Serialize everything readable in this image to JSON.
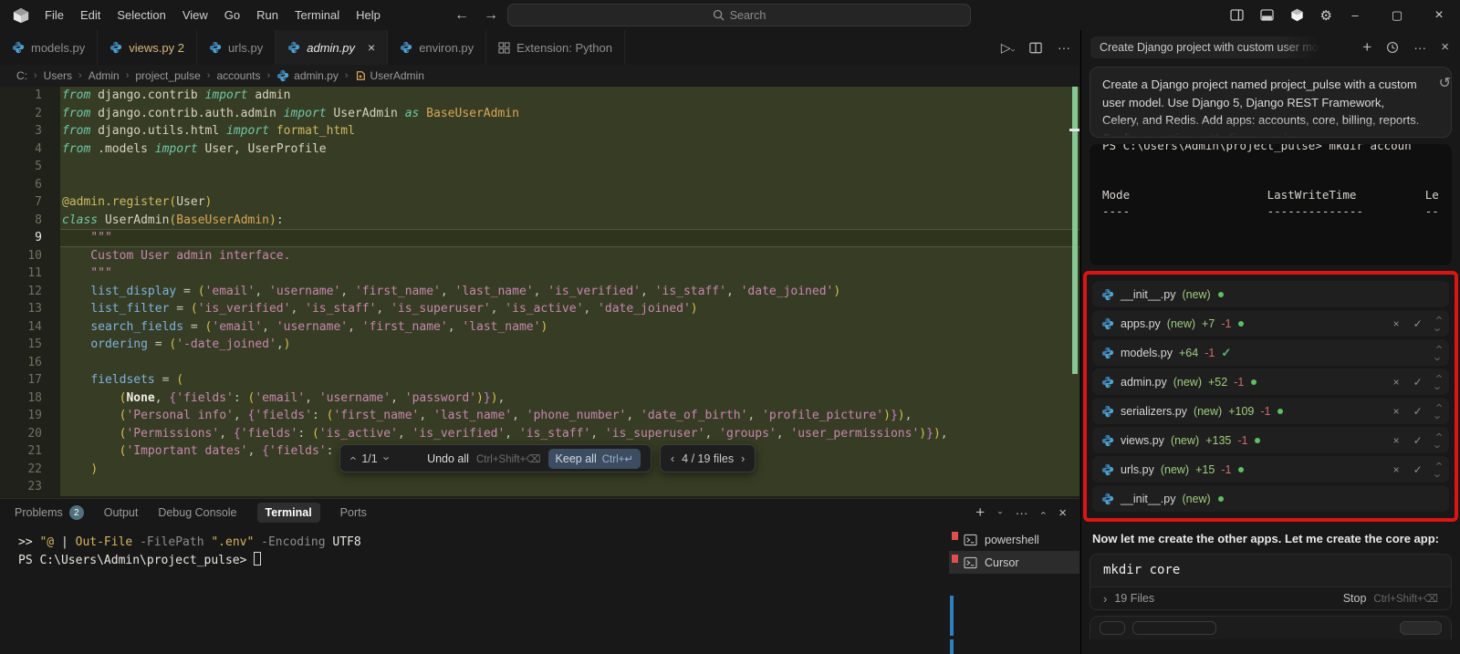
{
  "titlebar": {
    "menus": [
      "File",
      "Edit",
      "Selection",
      "View",
      "Go",
      "Run",
      "Terminal",
      "Help"
    ],
    "search_placeholder": "Search",
    "icons": {
      "back": "←",
      "forward": "→",
      "gear": "⚙",
      "minimize": "–",
      "restore": "▢",
      "close": "×"
    }
  },
  "tabs": [
    {
      "label": "models.py",
      "icon": "python",
      "state": "normal"
    },
    {
      "label": "views.py 2",
      "icon": "python",
      "state": "modified"
    },
    {
      "label": "urls.py",
      "icon": "python",
      "state": "normal"
    },
    {
      "label": "admin.py",
      "icon": "python",
      "state": "active",
      "close": "×"
    },
    {
      "label": "environ.py",
      "icon": "python",
      "state": "normal"
    },
    {
      "label": "Extension: Python",
      "icon": "extension",
      "state": "normal"
    }
  ],
  "editor_actions": {
    "run": "▷",
    "more": "···"
  },
  "breadcrumb": [
    {
      "label": "C:"
    },
    {
      "label": "Users"
    },
    {
      "label": "Admin"
    },
    {
      "label": "project_pulse"
    },
    {
      "label": "accounts"
    },
    {
      "label": "admin.py",
      "icon": "python"
    },
    {
      "label": "UserAdmin",
      "icon": "class"
    }
  ],
  "editor": {
    "lines": [
      {
        "n": 1,
        "t": [
          [
            "k",
            "from"
          ],
          [
            "p",
            " django.contrib "
          ],
          [
            "k",
            "import"
          ],
          [
            "p",
            " admin"
          ]
        ]
      },
      {
        "n": 2,
        "t": [
          [
            "k",
            "from"
          ],
          [
            "p",
            " django.contrib.auth.admin "
          ],
          [
            "k",
            "import"
          ],
          [
            "p",
            " UserAdmin "
          ],
          [
            "k",
            "as"
          ],
          [
            "t",
            " BaseUserAdmin"
          ]
        ]
      },
      {
        "n": 3,
        "t": [
          [
            "k",
            "from"
          ],
          [
            "p",
            " django.utils.html "
          ],
          [
            "k",
            "import"
          ],
          [
            "f",
            " format_html"
          ]
        ]
      },
      {
        "n": 4,
        "t": [
          [
            "k",
            "from"
          ],
          [
            "p",
            " .models "
          ],
          [
            "k",
            "import"
          ],
          [
            "p",
            " User, UserProfile"
          ]
        ]
      },
      {
        "n": 5,
        "t": []
      },
      {
        "n": 6,
        "t": []
      },
      {
        "n": 7,
        "t": [
          [
            "f",
            "@admin.register"
          ],
          [
            "y",
            "("
          ],
          [
            "p",
            "User"
          ],
          [
            "y",
            ")"
          ]
        ]
      },
      {
        "n": 8,
        "t": [
          [
            "k",
            "class"
          ],
          [
            "p",
            " UserAdmin"
          ],
          [
            "y",
            "("
          ],
          [
            "t",
            "BaseUserAdmin"
          ],
          [
            "y",
            ")"
          ],
          [
            "o",
            ":"
          ]
        ]
      },
      {
        "n": 9,
        "cur": true,
        "t": [
          [
            "s",
            "    \"\"\""
          ]
        ]
      },
      {
        "n": 10,
        "t": [
          [
            "s",
            "    Custom User admin interface."
          ]
        ]
      },
      {
        "n": 11,
        "t": [
          [
            "s",
            "    \"\"\""
          ]
        ]
      },
      {
        "n": 12,
        "t": [
          [
            "p",
            "    "
          ],
          [
            "b",
            "list_display"
          ],
          [
            "o",
            " = "
          ],
          [
            "y",
            "("
          ],
          [
            "s",
            "'email'"
          ],
          [
            "o",
            ", "
          ],
          [
            "s",
            "'username'"
          ],
          [
            "o",
            ", "
          ],
          [
            "s",
            "'first_name'"
          ],
          [
            "o",
            ", "
          ],
          [
            "s",
            "'last_name'"
          ],
          [
            "o",
            ", "
          ],
          [
            "s",
            "'is_verified'"
          ],
          [
            "o",
            ", "
          ],
          [
            "s",
            "'is_staff'"
          ],
          [
            "o",
            ", "
          ],
          [
            "s",
            "'date_joined'"
          ],
          [
            "y",
            ")"
          ]
        ]
      },
      {
        "n": 13,
        "t": [
          [
            "p",
            "    "
          ],
          [
            "b",
            "list_filter"
          ],
          [
            "o",
            " = "
          ],
          [
            "y",
            "("
          ],
          [
            "s",
            "'is_verified'"
          ],
          [
            "o",
            ", "
          ],
          [
            "s",
            "'is_staff'"
          ],
          [
            "o",
            ", "
          ],
          [
            "s",
            "'is_superuser'"
          ],
          [
            "o",
            ", "
          ],
          [
            "s",
            "'is_active'"
          ],
          [
            "o",
            ", "
          ],
          [
            "s",
            "'date_joined'"
          ],
          [
            "y",
            ")"
          ]
        ]
      },
      {
        "n": 14,
        "t": [
          [
            "p",
            "    "
          ],
          [
            "b",
            "search_fields"
          ],
          [
            "o",
            " = "
          ],
          [
            "y",
            "("
          ],
          [
            "s",
            "'email'"
          ],
          [
            "o",
            ", "
          ],
          [
            "s",
            "'username'"
          ],
          [
            "o",
            ", "
          ],
          [
            "s",
            "'first_name'"
          ],
          [
            "o",
            ", "
          ],
          [
            "s",
            "'last_name'"
          ],
          [
            "y",
            ")"
          ]
        ]
      },
      {
        "n": 15,
        "t": [
          [
            "p",
            "    "
          ],
          [
            "b",
            "ordering"
          ],
          [
            "o",
            " = "
          ],
          [
            "y",
            "("
          ],
          [
            "s",
            "'-date_joined'"
          ],
          [
            "o",
            ","
          ],
          [
            "y",
            ")"
          ]
        ]
      },
      {
        "n": 16,
        "t": []
      },
      {
        "n": 17,
        "t": [
          [
            "p",
            "    "
          ],
          [
            "b",
            "fieldsets"
          ],
          [
            "o",
            " = "
          ],
          [
            "y",
            "("
          ]
        ]
      },
      {
        "n": 18,
        "t": [
          [
            "p",
            "        "
          ],
          [
            "y",
            "("
          ],
          [
            "w",
            "None"
          ],
          [
            "o",
            ", "
          ],
          [
            "m",
            "{"
          ],
          [
            "s",
            "'fields'"
          ],
          [
            "o",
            ": "
          ],
          [
            "y",
            "("
          ],
          [
            "s",
            "'email'"
          ],
          [
            "o",
            ", "
          ],
          [
            "s",
            "'username'"
          ],
          [
            "o",
            ", "
          ],
          [
            "s",
            "'password'"
          ],
          [
            "y",
            ")"
          ],
          [
            "m",
            "}"
          ],
          [
            "y",
            ")"
          ],
          [
            "o",
            ","
          ]
        ]
      },
      {
        "n": 19,
        "t": [
          [
            "p",
            "        "
          ],
          [
            "y",
            "("
          ],
          [
            "s",
            "'Personal info'"
          ],
          [
            "o",
            ", "
          ],
          [
            "m",
            "{"
          ],
          [
            "s",
            "'fields'"
          ],
          [
            "o",
            ": "
          ],
          [
            "y",
            "("
          ],
          [
            "s",
            "'first_name'"
          ],
          [
            "o",
            ", "
          ],
          [
            "s",
            "'last_name'"
          ],
          [
            "o",
            ", "
          ],
          [
            "s",
            "'phone_number'"
          ],
          [
            "o",
            ", "
          ],
          [
            "s",
            "'date_of_birth'"
          ],
          [
            "o",
            ", "
          ],
          [
            "s",
            "'profile_picture'"
          ],
          [
            "y",
            ")"
          ],
          [
            "m",
            "}"
          ],
          [
            "y",
            ")"
          ],
          [
            "o",
            ","
          ]
        ]
      },
      {
        "n": 20,
        "t": [
          [
            "p",
            "        "
          ],
          [
            "y",
            "("
          ],
          [
            "s",
            "'Permissions'"
          ],
          [
            "o",
            ", "
          ],
          [
            "m",
            "{"
          ],
          [
            "s",
            "'fields'"
          ],
          [
            "o",
            ": "
          ],
          [
            "y",
            "("
          ],
          [
            "s",
            "'is_active'"
          ],
          [
            "o",
            ", "
          ],
          [
            "s",
            "'is_verified'"
          ],
          [
            "o",
            ", "
          ],
          [
            "s",
            "'is_staff'"
          ],
          [
            "o",
            ", "
          ],
          [
            "s",
            "'is_superuser'"
          ],
          [
            "o",
            ", "
          ],
          [
            "s",
            "'groups'"
          ],
          [
            "o",
            ", "
          ],
          [
            "s",
            "'user_permissions'"
          ],
          [
            "y",
            ")"
          ],
          [
            "m",
            "}"
          ],
          [
            "y",
            ")"
          ],
          [
            "o",
            ","
          ]
        ]
      },
      {
        "n": 21,
        "t": [
          [
            "p",
            "        "
          ],
          [
            "y",
            "("
          ],
          [
            "s",
            "'Important dates'"
          ],
          [
            "o",
            ", "
          ],
          [
            "m",
            "{"
          ],
          [
            "s",
            "'fields'"
          ],
          [
            "o",
            ":"
          ]
        ]
      },
      {
        "n": 22,
        "t": [
          [
            "p",
            "    "
          ],
          [
            "y",
            ")"
          ]
        ]
      },
      {
        "n": 23,
        "t": []
      }
    ]
  },
  "diff_widget": {
    "counter": "1/1",
    "undo_label": "Undo all",
    "undo_shortcut": "Ctrl+Shift+⌫",
    "keep_label": "Keep all",
    "keep_shortcut": "Ctrl+↵",
    "files_label": "4 / 19 files"
  },
  "panel": {
    "tabs": [
      {
        "label": "Problems",
        "badge": "2"
      },
      {
        "label": "Output"
      },
      {
        "label": "Debug Console"
      },
      {
        "label": "Terminal",
        "active": true
      },
      {
        "label": "Ports"
      }
    ],
    "terminal_lines": [
      [
        [
          "tw",
          ">> "
        ],
        [
          "ty",
          "\"@"
        ],
        [
          "tw",
          " | "
        ],
        [
          "ty",
          "Out-File"
        ],
        [
          "tg",
          " -FilePath "
        ],
        [
          "ty",
          "\".env\""
        ],
        [
          "tg",
          " -Encoding "
        ],
        [
          "tw",
          "UTF8"
        ]
      ],
      [
        [
          "tw",
          "PS C:\\Users\\Admin\\project_pulse> "
        ],
        [
          "cursor",
          ""
        ]
      ]
    ],
    "terminals": [
      {
        "label": "powershell",
        "selected": false
      },
      {
        "label": "Cursor",
        "selected": true
      }
    ]
  },
  "chat": {
    "title": "Create Django project with custom user mod",
    "user_message": "Create a Django project named project_pulse with a custom user model. Use Django 5, Django REST Framework, Celery, and Redis. Add apps: accounts, core, billing, reports. Configure settings with django-environ.",
    "terminal_output": [
      "PS C:\\Users\\Admin\\project_pulse> mkdir accoun",
      "",
      "",
      "Mode                    LastWriteTime          Le",
      "----                    --------------         --"
    ],
    "files": [
      {
        "name": "__init__.py",
        "new": "(new)",
        "dot": true,
        "actions": false,
        "expand": false
      },
      {
        "name": "apps.py",
        "new": "(new)",
        "added": "+7",
        "removed": "-1",
        "dot": true,
        "actions": true,
        "expand": true
      },
      {
        "name": "models.py",
        "added": "+64",
        "removed": "-1",
        "check": "✓",
        "actions": false,
        "expand": true
      },
      {
        "name": "admin.py",
        "new": "(new)",
        "added": "+52",
        "removed": "-1",
        "dot": true,
        "actions": true,
        "expand": true
      },
      {
        "name": "serializers.py",
        "new": "(new)",
        "added": "+109",
        "removed": "-1",
        "dot": true,
        "actions": true,
        "expand": true
      },
      {
        "name": "views.py",
        "new": "(new)",
        "added": "+135",
        "removed": "-1",
        "dot": true,
        "actions": true,
        "expand": true
      },
      {
        "name": "urls.py",
        "new": "(new)",
        "added": "+15",
        "removed": "-1",
        "dot": true,
        "actions": true,
        "expand": true
      },
      {
        "name": "__init__.py",
        "new": "(new)",
        "dot": true,
        "actions": false,
        "expand": false
      }
    ],
    "assistant_note": "Now let me create the other apps. Let me create the core app:",
    "command": "mkdir core",
    "files_summary": {
      "label": "19 Files",
      "stop": "Stop",
      "shortcut": "Ctrl+Shift+⌫"
    }
  },
  "colors": {
    "diff_added_bg": "#373d24",
    "red_annotation": "#dd1414",
    "added_green": "#9fcd7f",
    "removed_red": "#d16d6d",
    "python_blue": "#4fa3d1"
  }
}
